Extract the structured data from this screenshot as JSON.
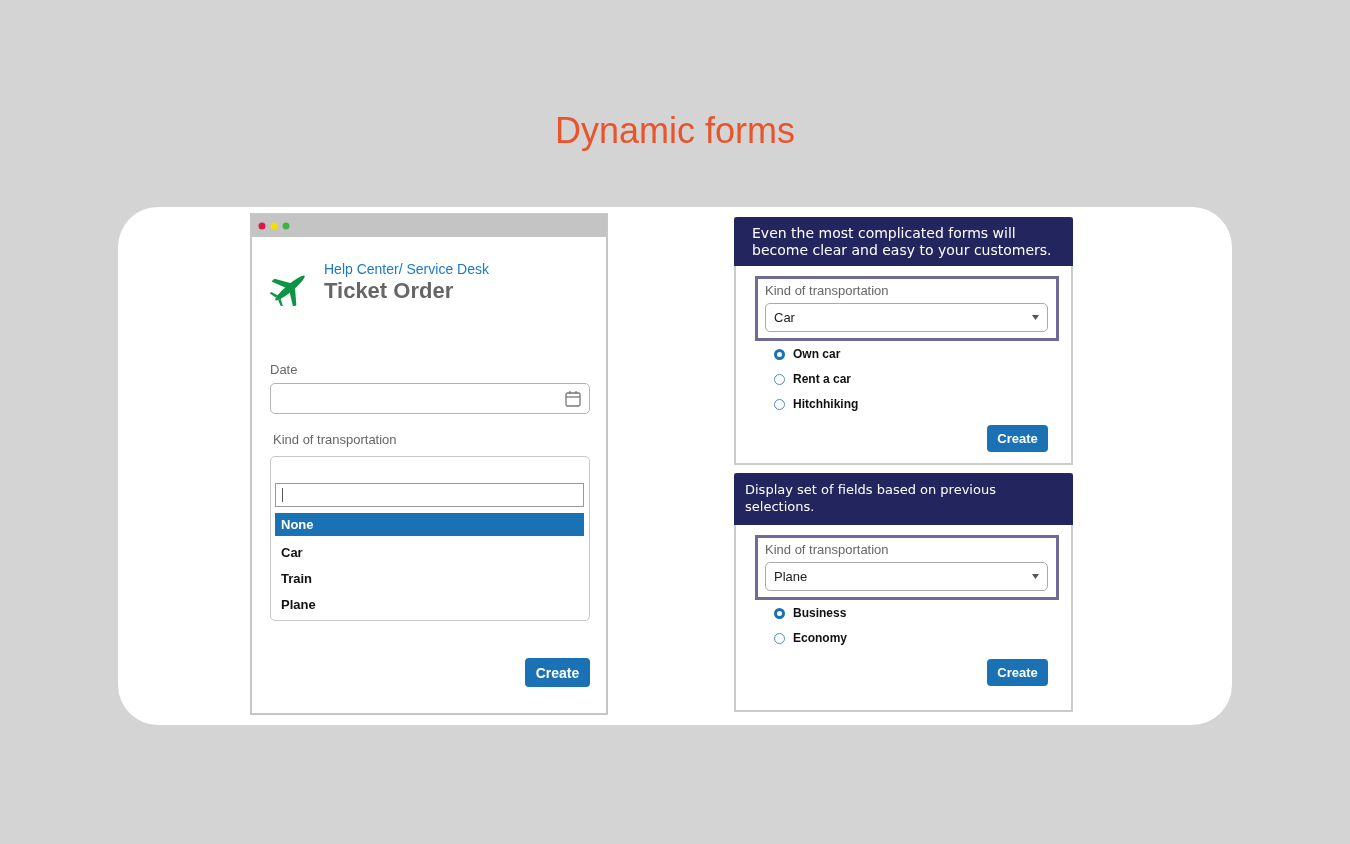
{
  "page_title": "Dynamic forms",
  "ticket_window": {
    "subtitle": "Help Center/ Service Desk",
    "title": "Ticket Order",
    "date_label": "Date",
    "transport_label": "Kind of transportation",
    "options": [
      {
        "label": "None",
        "selected": true
      },
      {
        "label": "Car",
        "selected": false
      },
      {
        "label": "Train",
        "selected": false
      },
      {
        "label": "Plane",
        "selected": false
      }
    ],
    "button": "Create"
  },
  "examples": [
    {
      "caption": "Even the most complicated forms will become clear and easy to your customers.",
      "field_label": "Kind of transportation",
      "value": "Car",
      "options": [
        {
          "label": "Own car",
          "selected": true
        },
        {
          "label": "Rent a car",
          "selected": false
        },
        {
          "label": "Hitchhiking",
          "selected": false
        }
      ],
      "button": "Create"
    },
    {
      "caption": "Display set of fields based on previous selections.",
      "field_label": "Kind of transportation",
      "value": "Plane",
      "options": [
        {
          "label": "Business",
          "selected": true
        },
        {
          "label": "Economy",
          "selected": false
        }
      ],
      "button": "Create"
    }
  ]
}
